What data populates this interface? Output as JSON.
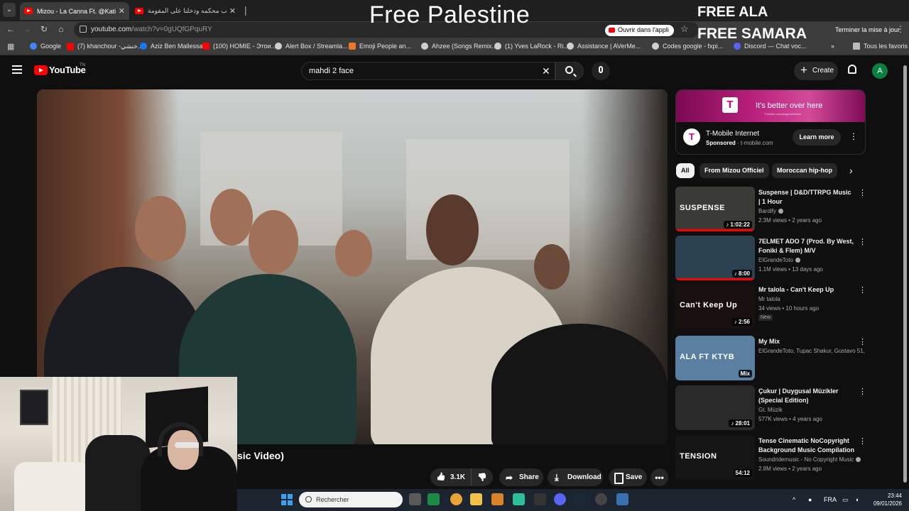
{
  "browser": {
    "tabs": [
      {
        "title": "Mizou - La Canna Ft. @KatibaSe",
        "active": true
      },
      {
        "title": "كليب محكمه ودخلنا على المقومة",
        "active": false
      }
    ],
    "url_domain": "youtube.com",
    "url_path": "/watch?v=0gUQfGPquRY",
    "open_in_app_label": "Ouvrir dans l'appli",
    "update_label": "Terminer la mise à jour",
    "bookmarks": [
      "Google",
      "(7) khanchour -خنشي...",
      "Aziz Ben Mallessa",
      "(100) HOMIE - Этои...",
      "Alert Box / Streamla...",
      "Emoji People an...",
      "Ahzee (Songs Remix...",
      "(1) Yves LaRock - Ri...",
      "Assistance | AVerMe...",
      "Codes google - fxpi...",
      "Discord — Chat voc..."
    ],
    "all_bookmarks_label": "Tous les favoris"
  },
  "stream_overlay": {
    "center_text": "Free Palestine",
    "line1": "FREE ALA",
    "line2": "FREE SAMARA"
  },
  "youtube": {
    "logo_text": "YouTube",
    "logo_region": "TN",
    "search_value": "mahdi 2 face",
    "create_label": "Create",
    "avatar_letter": "A",
    "video_title_visible": "sic Video)",
    "actions": {
      "likes": "3.1K",
      "share": "Share",
      "download": "Download",
      "save": "Save"
    },
    "ad": {
      "banner_text": "It's better over here",
      "banner_url": "T-Mobile.com/MagentaStatus",
      "logo_letter": "T",
      "title": "T-Mobile Internet",
      "sponsored_label": "Sponsored",
      "domain": "t-mobile.com",
      "cta": "Learn more"
    },
    "chips": [
      "All",
      "From Mizou Officiel",
      "Moroccan hip-hop"
    ],
    "recommendations": [
      {
        "title": "Suspense | D&D/TTRPG Music | 1 Hour",
        "channel": "Bardify",
        "verified": true,
        "meta": "2.3M views • 2 years ago",
        "duration": "♪ 1:02:22",
        "thumb_label": "SUSPENSE",
        "thumb_color": "#3a3a36",
        "progress": 1.0
      },
      {
        "title": "7ELMET ADO 7 (Prod. By West, Foniki & Flem) M/V",
        "channel": "ElGrandeToto",
        "verified": true,
        "meta": "1.1M views • 13 days ago",
        "duration": "♪ 8:00",
        "thumb_label": "",
        "thumb_color": "#2d4250",
        "progress": 1.0
      },
      {
        "title": "Mr talola - Can't Keep Up",
        "channel": "Mr talola",
        "verified": false,
        "meta": "34 views • 10 hours ago",
        "badge": "New",
        "duration": "♪ 2:56",
        "thumb_label": "Can't Keep Up",
        "thumb_color": "#1a1010",
        "progress": 0
      },
      {
        "title": "My Mix",
        "channel": "ElGrandeToto, Tupac Shakur, Gustavo 51,...",
        "verified": false,
        "meta": "",
        "duration": "Mix",
        "thumb_label": "ALA FT KTYB",
        "thumb_color": "#5a7fa0",
        "progress": 0
      },
      {
        "title": "Çukur | Duygusal Müzikler (Special Edition)",
        "channel": "Gt. Müzik",
        "verified": false,
        "meta": "577K views • 4 years ago",
        "duration": "♪ 28:01",
        "thumb_label": "",
        "thumb_color": "#2a2a2a",
        "progress": 0
      },
      {
        "title": "Tense Cinematic NoCopyright Background Music Compilation",
        "channel": "Soundridemusic - No Copyright Music",
        "verified": true,
        "meta": "2.8M views • 2 years ago",
        "duration": "54:12",
        "thumb_label": "TENSION",
        "thumb_color": "#151515",
        "progress": 0
      }
    ]
  },
  "taskbar": {
    "search_placeholder": "Rechercher",
    "language": "FRA",
    "time": "23:44",
    "date": "09/01/2026"
  }
}
